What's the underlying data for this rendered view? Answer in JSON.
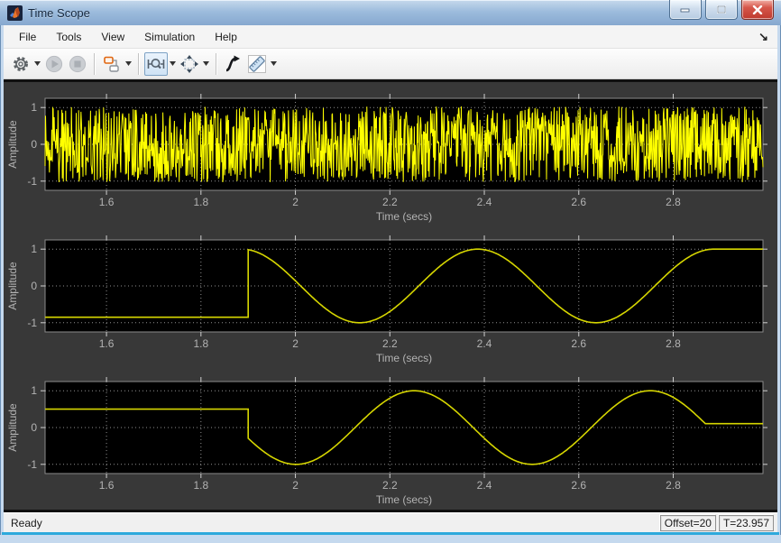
{
  "window": {
    "title": "Time Scope",
    "controls": {
      "minimize": "minimize",
      "maximize": "maximize",
      "close": "close"
    }
  },
  "menu": {
    "items": [
      "File",
      "Tools",
      "View",
      "Simulation",
      "Help"
    ]
  },
  "toolbar": {
    "buttons": [
      "configuration",
      "play",
      "stop",
      "source-blocks",
      "zoom-x",
      "scale-axes",
      "step-forward",
      "measurements"
    ],
    "zoom_x_pressed": true,
    "play_enabled": false,
    "stop_enabled": false
  },
  "status": {
    "ready": "Ready",
    "offset": "Offset=20",
    "time": "T=23.957"
  },
  "colors": {
    "signal_noise": "#ffff00",
    "signal_sine": "#d6d600",
    "panel_bg": "#383838",
    "axes_bg": "#000000",
    "axes_frame": "#8a8a8a",
    "grid": "#aaaaaa",
    "tick_label": "#b3b3b3",
    "titlebar_blue": "#9dbcdd",
    "close_red": "#d6564a",
    "status_bg": "#f0f0f0"
  },
  "chart_data": [
    {
      "type": "line",
      "title": "",
      "xlabel": "Time (secs)",
      "ylabel": "Amplitude",
      "xlim": [
        1.47,
        2.99
      ],
      "ylim": [
        -1.25,
        1.25
      ],
      "xticks": [
        1.6,
        1.8,
        2.0,
        2.2,
        2.4,
        2.6,
        2.8
      ],
      "xtick_labels": [
        "1.6",
        "1.8",
        "2",
        "2.2",
        "2.4",
        "2.6",
        "2.8"
      ],
      "yticks": [
        1,
        0,
        -1
      ],
      "ytick_labels": [
        "1",
        "0",
        "-1"
      ],
      "grid": true,
      "line_color": "#ffff00",
      "line_width": 1,
      "signal": {
        "kind": "noise",
        "seed": 123456789,
        "samples": 1500,
        "amplitude": 1.03
      }
    },
    {
      "type": "line",
      "title": "",
      "xlabel": "Time (secs)",
      "ylabel": "Amplitude",
      "xlim": [
        1.47,
        2.99
      ],
      "ylim": [
        -1.25,
        1.25
      ],
      "xticks": [
        1.6,
        1.8,
        2.0,
        2.2,
        2.4,
        2.6,
        2.8
      ],
      "xtick_labels": [
        "1.6",
        "1.8",
        "2",
        "2.2",
        "2.4",
        "2.6",
        "2.8"
      ],
      "yticks": [
        1,
        0,
        -1
      ],
      "ytick_labels": [
        "1",
        "0",
        "-1"
      ],
      "grid": true,
      "line_color": "#d6d600",
      "line_width": 1.6,
      "signal": {
        "kind": "segments",
        "segments": [
          {
            "type": "const",
            "t0": 1.47,
            "t1": 1.9,
            "value": -0.85
          },
          {
            "type": "sine",
            "t0": 1.9,
            "t1": 2.886,
            "amplitude": 1.0,
            "freq_hz": 2.0,
            "phase_deg": 100
          },
          {
            "type": "const",
            "t0": 2.886,
            "t1": 2.99,
            "value": 1.0
          }
        ]
      }
    },
    {
      "type": "line",
      "title": "",
      "xlabel": "Time (secs)",
      "ylabel": "Amplitude",
      "xlim": [
        1.47,
        2.99
      ],
      "ylim": [
        -1.25,
        1.25
      ],
      "xticks": [
        1.6,
        1.8,
        2.0,
        2.2,
        2.4,
        2.6,
        2.8
      ],
      "xtick_labels": [
        "1.6",
        "1.8",
        "2",
        "2.2",
        "2.4",
        "2.6",
        "2.8"
      ],
      "yticks": [
        1,
        0,
        -1
      ],
      "ytick_labels": [
        "1",
        "0",
        "-1"
      ],
      "grid": true,
      "line_color": "#d6d600",
      "line_width": 1.6,
      "signal": {
        "kind": "segments",
        "segments": [
          {
            "type": "const",
            "t0": 1.47,
            "t1": 1.9,
            "value": 0.5
          },
          {
            "type": "sine",
            "t0": 1.9,
            "t1": 2.868,
            "amplitude": 1.0,
            "freq_hz": 2.0,
            "phase_deg": 197
          },
          {
            "type": "const",
            "t0": 2.868,
            "t1": 2.99,
            "value": 0.105
          }
        ]
      }
    }
  ]
}
